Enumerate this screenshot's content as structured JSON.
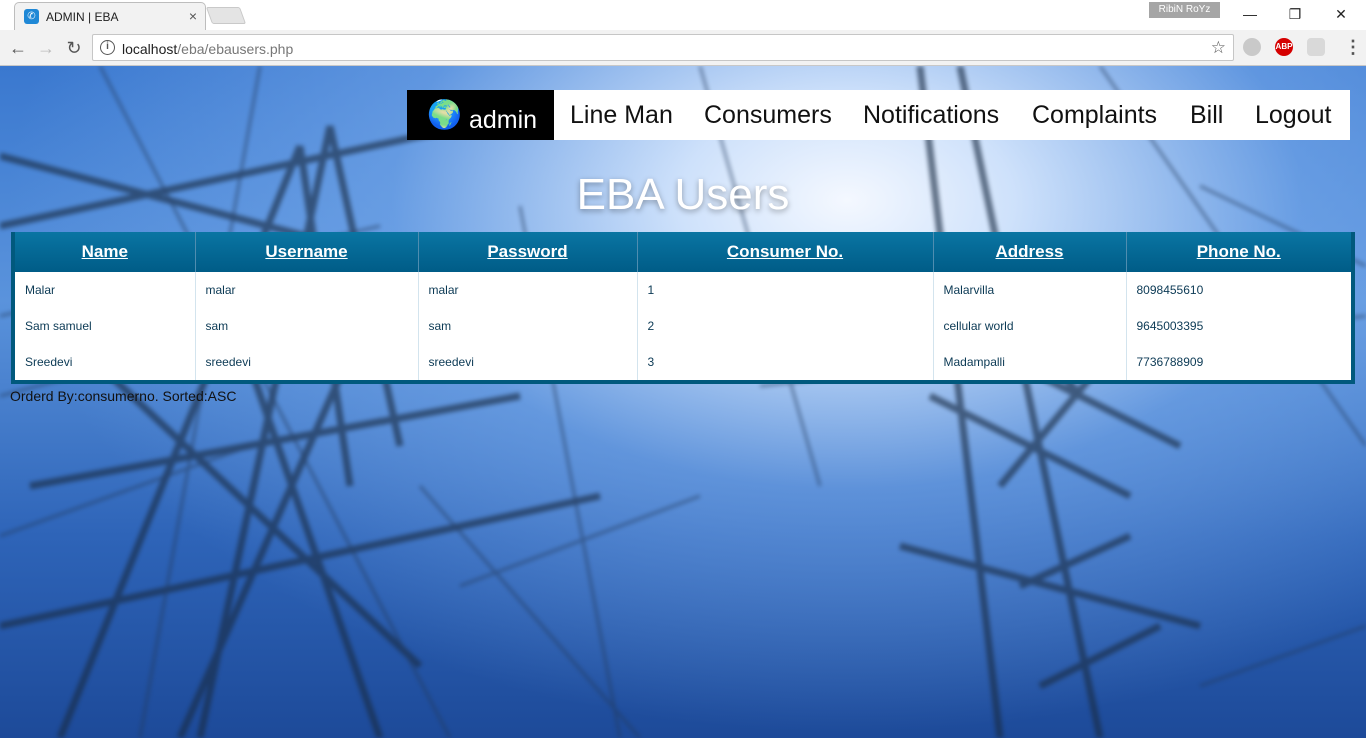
{
  "browser": {
    "tab_title": "ADMIN | EBA",
    "tab_close": "×",
    "profile_name": "RibiN RoYz",
    "url_host": "localhost",
    "url_path": "/eba/ebausers.php",
    "info_glyph": "i",
    "star_glyph": "☆",
    "back_glyph": "←",
    "forward_glyph": "→",
    "reload_glyph": "↻",
    "minimize_glyph": "—",
    "restore_glyph": "❐",
    "close_glyph": "✕",
    "abp_label": "ABP",
    "menu_glyph": "⋮"
  },
  "nav": {
    "brand_glyph": "🌍",
    "brand": "admin",
    "items": [
      "Line Man",
      "Consumers",
      "Notifications",
      "Complaints",
      "Bill",
      "Logout"
    ]
  },
  "page_title": "EBA Users",
  "table": {
    "headers": [
      "Name",
      "Username",
      "Password",
      "Consumer No.",
      "Address",
      "Phone No."
    ],
    "rows": [
      [
        "Malar",
        "malar",
        "malar",
        "1",
        "Malarvilla",
        "8098455610"
      ],
      [
        "Sam samuel",
        "sam",
        "sam",
        "2",
        "cellular world",
        "9645003395"
      ],
      [
        "Sreedevi",
        "sreedevi",
        "sreedevi",
        "3",
        "Madampalli",
        "7736788909"
      ]
    ]
  },
  "footer_note": "Orderd By:consumerno. Sorted:ASC"
}
